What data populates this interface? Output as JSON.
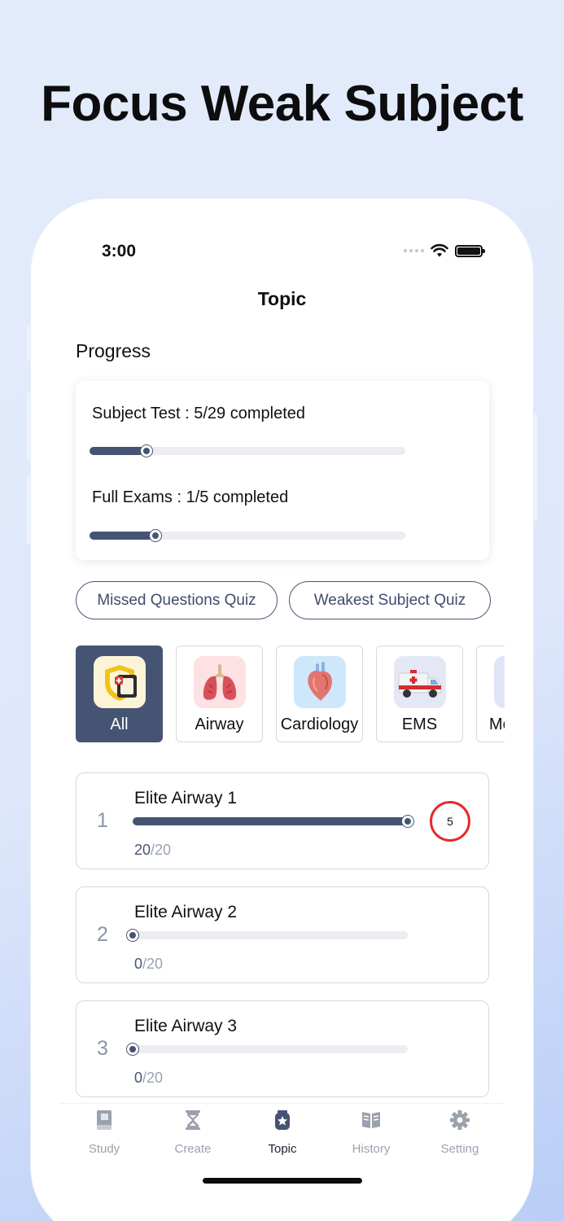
{
  "headline": "Focus Weak Subject",
  "status": {
    "time": "3:00"
  },
  "nav": {
    "title": "Topic"
  },
  "progress": {
    "section_title": "Progress",
    "subject_test": {
      "label": "Subject Test : 5/29 completed",
      "fraction": 0.18
    },
    "full_exams": {
      "label": "Full Exams : 1/5 completed",
      "fraction": 0.21
    }
  },
  "quiz_buttons": {
    "missed": "Missed Questions Quiz",
    "weakest": "Weakest Subject Quiz"
  },
  "categories": [
    {
      "label": "All",
      "icon": "all-icon",
      "active": true
    },
    {
      "label": "Airway",
      "icon": "lungs-icon",
      "active": false
    },
    {
      "label": "Cardiology",
      "icon": "heart-icon",
      "active": false
    },
    {
      "label": "EMS",
      "icon": "ambulance-icon",
      "active": false
    },
    {
      "label": "Me",
      "icon": "medical-icon",
      "active": false
    }
  ],
  "topics": [
    {
      "number": "1",
      "title": "Elite Airway 1",
      "done": "20",
      "total": "/20",
      "progress": 1.0,
      "badge": "5"
    },
    {
      "number": "2",
      "title": "Elite Airway 2",
      "done": "0",
      "total": "/20",
      "progress": 0.0
    },
    {
      "number": "3",
      "title": "Elite Airway 3",
      "done": "0",
      "total": "/20",
      "progress": 0.0
    }
  ],
  "tabs": [
    {
      "label": "Study",
      "icon": "book-icon"
    },
    {
      "label": "Create",
      "icon": "hourglass-icon"
    },
    {
      "label": "Topic",
      "icon": "badge-star-icon",
      "active": true
    },
    {
      "label": "History",
      "icon": "open-book-icon"
    },
    {
      "label": "Setting",
      "icon": "gear-icon"
    }
  ],
  "colors": {
    "accent": "#465473",
    "badge_ring": "#e52a2a",
    "track": "#ebedf1"
  }
}
